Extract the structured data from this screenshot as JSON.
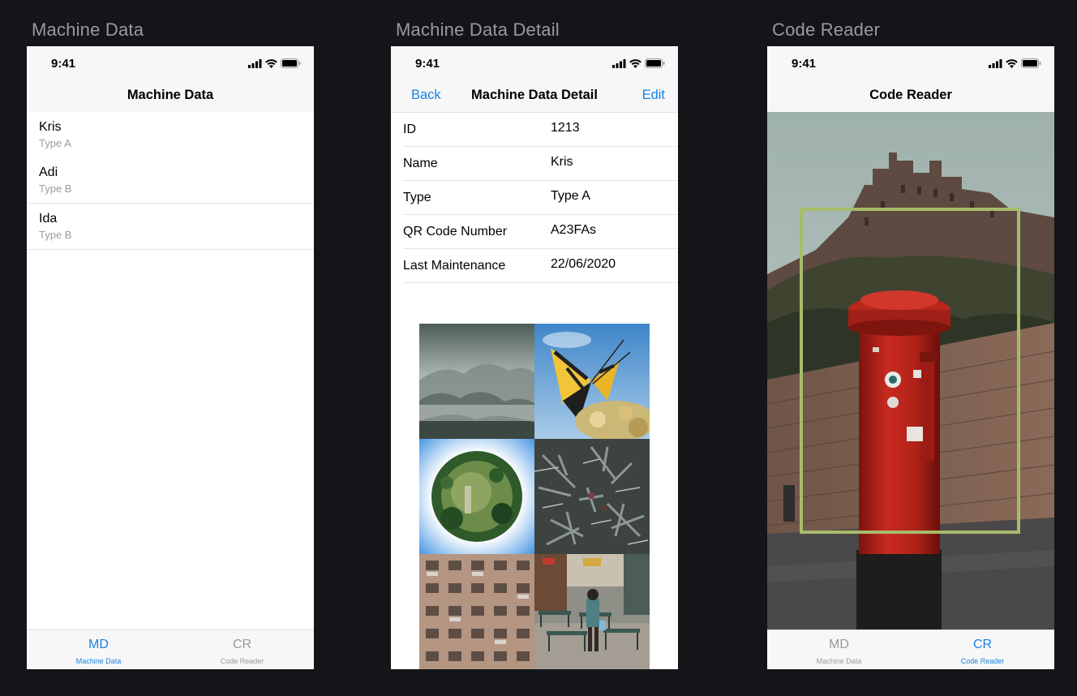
{
  "status_time": "9:41",
  "screens": {
    "machine_data": {
      "frame_title": "Machine Data",
      "nav_title": "Machine Data",
      "items": [
        {
          "name": "Kris",
          "type": "Type A"
        },
        {
          "name": "Adi",
          "type": "Type B"
        },
        {
          "name": "Ida",
          "type": "Type B"
        }
      ]
    },
    "machine_data_detail": {
      "frame_title": "Machine Data Detail",
      "nav_title": "Machine Data Detail",
      "back_label": "Back",
      "edit_label": "Edit",
      "fields": [
        {
          "label": "ID",
          "value": "1213"
        },
        {
          "label": "Name",
          "value": "Kris"
        },
        {
          "label": "Type",
          "value": "Type A"
        },
        {
          "label": "QR Code Number",
          "value": "A23FAs"
        },
        {
          "label": "Last Maintenance",
          "value": "22/06/2020"
        }
      ]
    },
    "code_reader": {
      "frame_title": "Code Reader",
      "nav_title": "Code Reader"
    }
  },
  "tabs": {
    "md": {
      "icon": "MD",
      "label": "Machine Data"
    },
    "cr": {
      "icon": "CR",
      "label": "Code Reader"
    }
  },
  "colors": {
    "accent": "#1a82e6",
    "scan_frame": "#a7bc6b",
    "background": "#141518"
  }
}
